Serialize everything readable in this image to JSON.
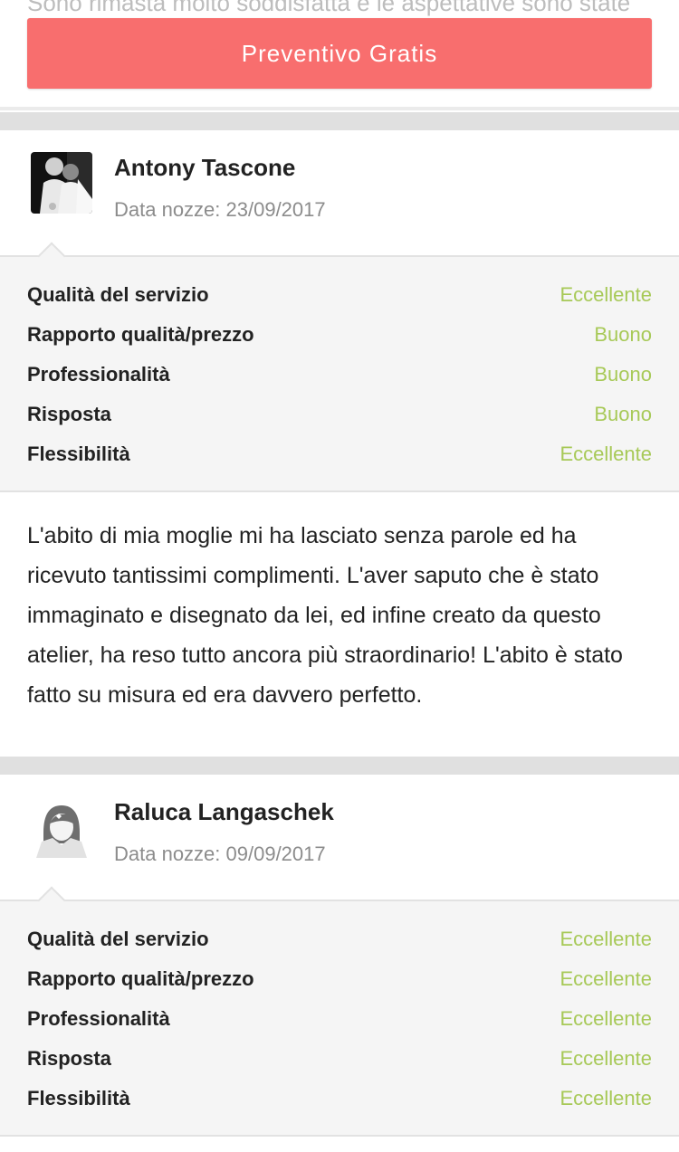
{
  "top": {
    "cut_text": "Sono rimasta molto soddisfatta e le aspettative sono state",
    "cta_label": "Preventivo Gratis"
  },
  "reviews": [
    {
      "author": "Antony Tascone",
      "wedding_date": "Data nozze: 23/09/2017",
      "ratings": [
        {
          "label": "Qualità del servizio",
          "value": "Eccellente"
        },
        {
          "label": "Rapporto qualità/prezzo",
          "value": "Buono"
        },
        {
          "label": "Professionalità",
          "value": "Buono"
        },
        {
          "label": "Risposta",
          "value": "Buono"
        },
        {
          "label": "Flessibilità",
          "value": "Eccellente"
        }
      ],
      "comment": "L'abito di mia moglie mi ha lasciato senza parole ed ha ricevuto tantissimi complimenti. L'aver saputo che è stato immaginato e disegnato da lei, ed infine creato da questo atelier, ha reso tutto ancora più straordinario! L'abito è stato fatto su misura ed era davvero perfetto."
    },
    {
      "author": "Raluca Langaschek",
      "wedding_date": "Data nozze: 09/09/2017",
      "ratings": [
        {
          "label": "Qualità del servizio",
          "value": "Eccellente"
        },
        {
          "label": "Rapporto qualità/prezzo",
          "value": "Eccellente"
        },
        {
          "label": "Professionalità",
          "value": "Eccellente"
        },
        {
          "label": "Risposta",
          "value": "Eccellente"
        },
        {
          "label": "Flessibilità",
          "value": "Eccellente"
        }
      ]
    }
  ],
  "colors": {
    "cta": "#f86e6e",
    "rating_value": "#a7c957",
    "separator": "#e0e0e0"
  }
}
